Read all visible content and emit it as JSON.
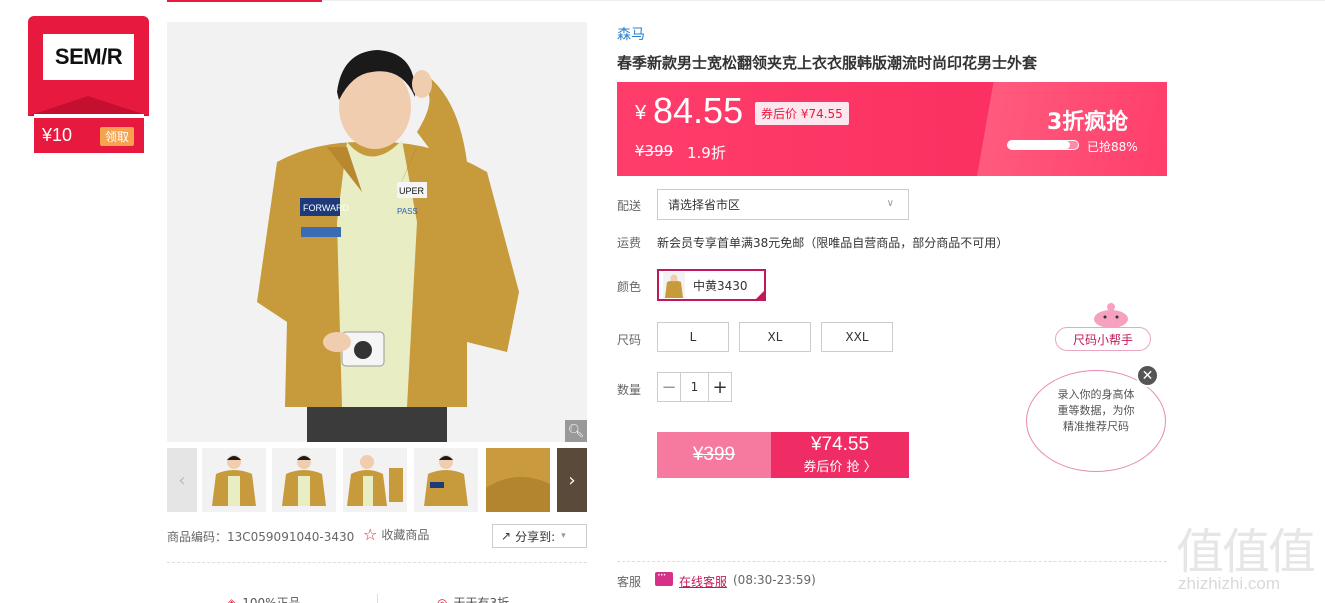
{
  "store": {
    "logo_text": "SEM/R",
    "coupon_value": "¥10",
    "coupon_claim": "领取"
  },
  "gallery": {
    "zoom_icon": "magnifier-icon",
    "thumbnail_count": 6,
    "prev_icon": "chevron-left-icon",
    "next_icon": "chevron-right-icon"
  },
  "product": {
    "brand": "森马",
    "title": "春季新款男士宽松翻领夹克上衣衣服韩版潮流时尚印花男士外套",
    "sku_label": "商品编码：13C059091040-3430",
    "favorite_label": "收藏商品",
    "share_label": "分享到:"
  },
  "price": {
    "currency": "¥",
    "current": "84.55",
    "coupon_price": "券后价 ¥74.55",
    "original": "¥399",
    "discount": "1.9折",
    "flash_title": "3折疯抢",
    "sold_text": "已抢88%",
    "sold_fraction": 0.88
  },
  "options": {
    "delivery_label": "配送",
    "delivery_placeholder": "请选择省市区",
    "shipping_label": "运费",
    "shipping_text": "新会员专享首单满38元免邮（限唯品自营商品，部分商品不可用）",
    "color_label": "颜色",
    "color_value": "中黄3430",
    "size_label": "尺码",
    "sizes": [
      "L",
      "XL",
      "XXL"
    ],
    "qty_label": "数量",
    "qty_value": "1"
  },
  "buy": {
    "original": "¥399",
    "coupon_price": "¥74.55",
    "coupon_cta": "券后价 抢 〉"
  },
  "service": {
    "label": "客服",
    "link": "在线客服",
    "hours": "(08:30-23:59)"
  },
  "bottom": {
    "item1": "100%正品",
    "item2": "天天有3折"
  },
  "size_helper": {
    "tag": "尺码小帮手",
    "bubble_line1": "录入你的身高体",
    "bubble_line2": "重等数据，为你",
    "bubble_line3": "精准推荐尺码"
  },
  "watermark": {
    "chars": "值值值",
    "url": "zhizhizhi.com"
  },
  "colors": {
    "accent": "#e8193f",
    "price_bg": "#f72b5d",
    "brand_link": "#2c7fc7",
    "selected_border": "#c2185b"
  }
}
